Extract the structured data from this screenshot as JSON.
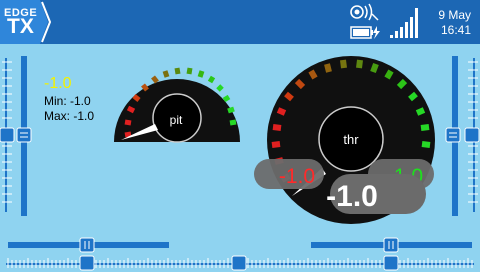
{
  "header": {
    "logo_line1": "EDGE",
    "logo_line2": "TX",
    "date": "9 May",
    "time": "16:41",
    "icons": [
      "usb-icon",
      "audio-icon",
      "battery-charging-icon",
      "signal-bars-icon"
    ]
  },
  "widget_values": {
    "current": "-1.0",
    "min": "Min: -1.0",
    "max": "Max: -1.0"
  },
  "gauges": {
    "left": {
      "label": "pit",
      "value_fraction": 0.0
    },
    "right": {
      "label": "thr",
      "value_fraction": 0.0
    }
  },
  "overlay": {
    "left_value": "-1.0",
    "right_value": "-1.0",
    "center_value": "-1.0"
  },
  "colors": {
    "header": "#1c67b4",
    "background": "#8fd3f0",
    "trim_blue": "#1e74c8",
    "gauge_green": "#26d826",
    "gauge_red": "#e02020"
  }
}
